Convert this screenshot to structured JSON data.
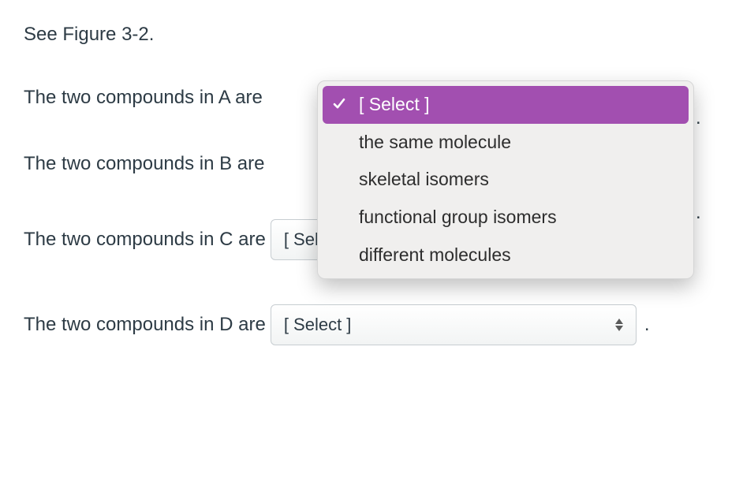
{
  "heading": "See Figure 3-2.",
  "rows": [
    {
      "text": "The two compounds in A are",
      "selected": "[ Select ]"
    },
    {
      "text": "The two compounds in B are",
      "selected": "[ Select ]"
    },
    {
      "text": "The two compounds in C are",
      "selected": "[ Select ]"
    },
    {
      "text": "The two compounds in D are",
      "selected": "[ Select ]"
    }
  ],
  "dropdown": {
    "placeholder": "[ Select ]",
    "options": [
      "the same molecule",
      "skeletal isomers",
      "functional group isomers",
      "different molecules"
    ]
  },
  "period": "."
}
